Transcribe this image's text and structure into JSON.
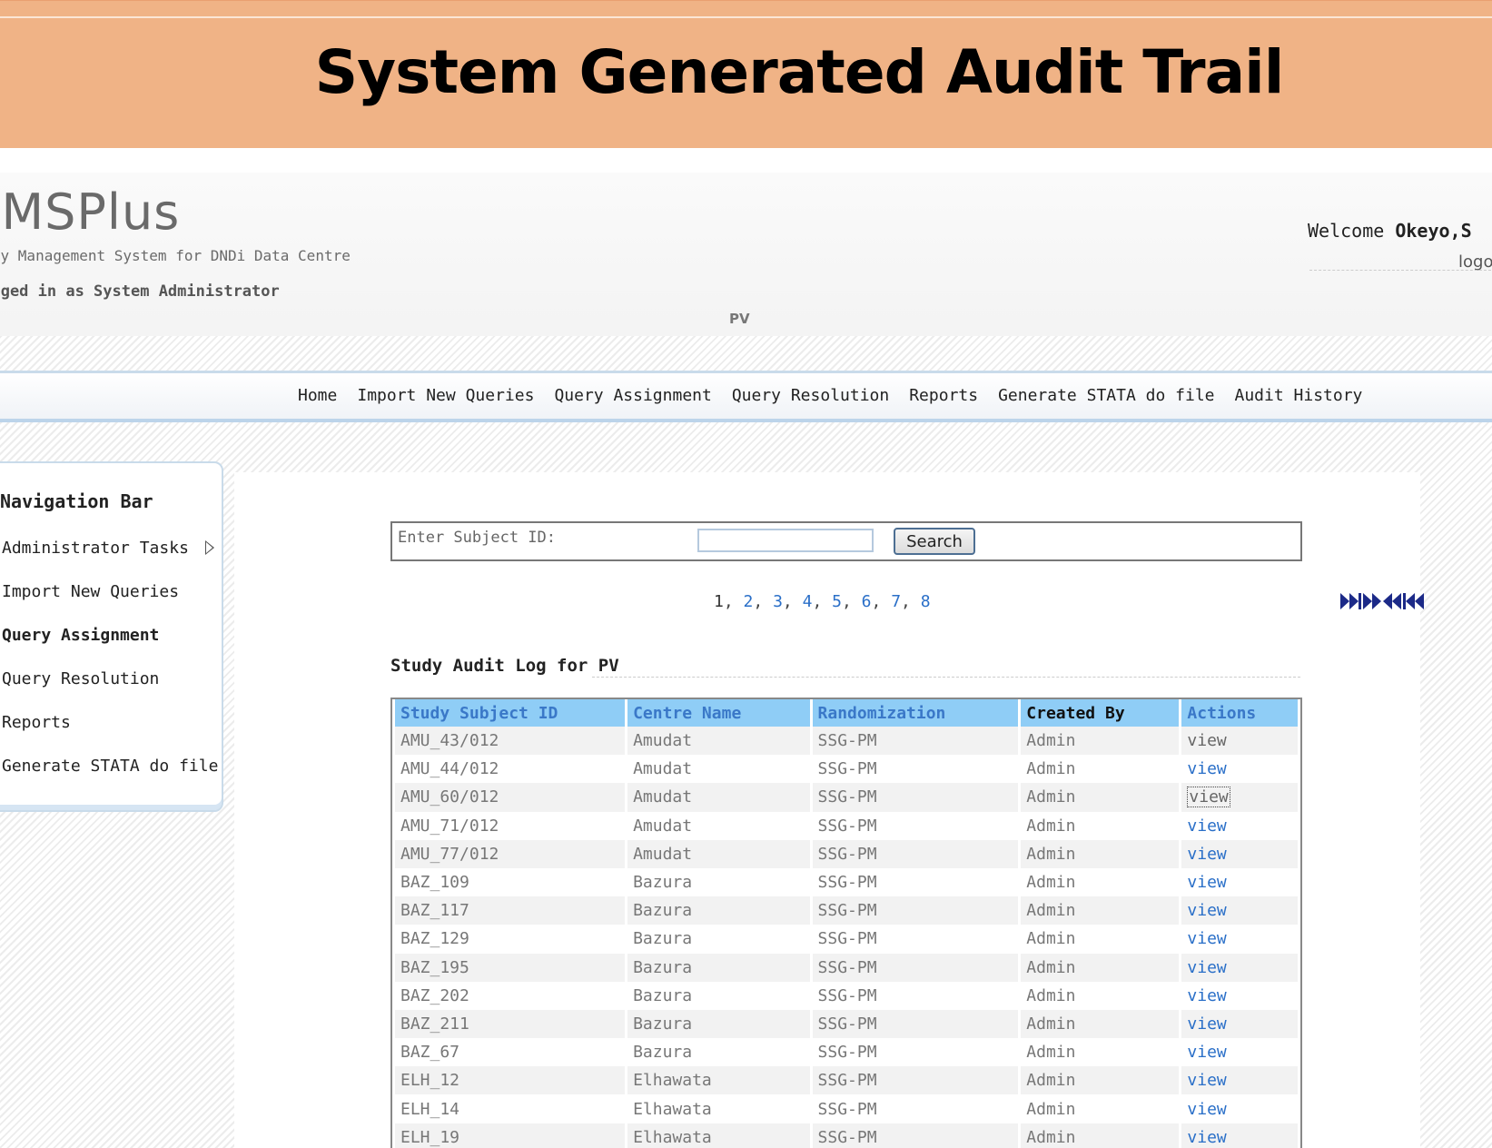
{
  "slide": {
    "title": "System Generated Audit Trail"
  },
  "header": {
    "logo": "QMSPlus",
    "subtitle": "Query Management System for DNDi Data Centre",
    "logged_in": "Logged in as System Administrator",
    "study_code": "PV",
    "welcome_label": "Welcome",
    "welcome_user": "Okeyo,S",
    "logout": "logout"
  },
  "nav": {
    "items": [
      "Home",
      "Import New Queries",
      "Query Assignment",
      "Query Resolution",
      "Reports",
      "Generate STATA do file",
      "Audit History"
    ]
  },
  "sidebar": {
    "title": "Navigation Bar",
    "items": [
      {
        "label": "Administrator Tasks"
      },
      {
        "label": "Import New Queries"
      },
      {
        "label": "Query Assignment"
      },
      {
        "label": "Query Resolution"
      },
      {
        "label": "Reports"
      },
      {
        "label": "Generate STATA do file"
      }
    ]
  },
  "search": {
    "label": "Enter Subject ID:",
    "value": "",
    "button": "Search"
  },
  "pagination": {
    "pages": [
      "1",
      "2",
      "3",
      "4",
      "5",
      "6",
      "7",
      "8"
    ],
    "current": "1"
  },
  "table": {
    "title": "Study Audit Log for PV",
    "headers": [
      "Study Subject ID",
      "Centre Name",
      "Randomization",
      "Created By",
      "Actions"
    ],
    "rows": [
      [
        "AMU_43/012",
        "Amudat",
        "SSG-PM",
        "Admin",
        "view"
      ],
      [
        "AMU_44/012",
        "Amudat",
        "SSG-PM",
        "Admin",
        "view"
      ],
      [
        "AMU_60/012",
        "Amudat",
        "SSG-PM",
        "Admin",
        "view"
      ],
      [
        "AMU_71/012",
        "Amudat",
        "SSG-PM",
        "Admin",
        "view"
      ],
      [
        "AMU_77/012",
        "Amudat",
        "SSG-PM",
        "Admin",
        "view"
      ],
      [
        "BAZ_109",
        "Bazura",
        "SSG-PM",
        "Admin",
        "view"
      ],
      [
        "BAZ_117",
        "Bazura",
        "SSG-PM",
        "Admin",
        "view"
      ],
      [
        "BAZ_129",
        "Bazura",
        "SSG-PM",
        "Admin",
        "view"
      ],
      [
        "BAZ_195",
        "Bazura",
        "SSG-PM",
        "Admin",
        "view"
      ],
      [
        "BAZ_202",
        "Bazura",
        "SSG-PM",
        "Admin",
        "view"
      ],
      [
        "BAZ_211",
        "Bazura",
        "SSG-PM",
        "Admin",
        "view"
      ],
      [
        "BAZ_67",
        "Bazura",
        "SSG-PM",
        "Admin",
        "view"
      ],
      [
        "ELH_12",
        "Elhawata",
        "SSG-PM",
        "Admin",
        "view"
      ],
      [
        "ELH_14",
        "Elhawata",
        "SSG-PM",
        "Admin",
        "view"
      ],
      [
        "ELH_19",
        "Elhawata",
        "SSG-PM",
        "Admin",
        "view"
      ]
    ]
  },
  "colors": {
    "banner": "#f0b386",
    "header_cell": "#8fcdf6",
    "link": "#2a6fc8"
  }
}
